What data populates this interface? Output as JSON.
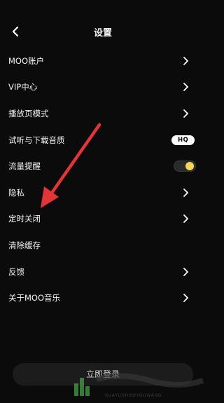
{
  "header": {
    "title": "设置"
  },
  "settings": {
    "items": [
      {
        "label": "MOO账户",
        "control": "chevron"
      },
      {
        "label": "VIP中心",
        "control": "chevron"
      },
      {
        "label": "播放页模式",
        "control": "chevron"
      },
      {
        "label": "试听与下载音质",
        "control": "badge",
        "badge": "HQ"
      },
      {
        "label": "流量提醒",
        "control": "toggle",
        "toggle_on": true
      },
      {
        "label": "隐私",
        "control": "chevron"
      },
      {
        "label": "定时关闭",
        "control": "chevron"
      },
      {
        "label": "清除缓存",
        "control": "none"
      },
      {
        "label": "反馈",
        "control": "chevron"
      },
      {
        "label": "关于MOO音乐",
        "control": "chevron"
      }
    ]
  },
  "footer": {
    "logout_label": "立即登录"
  },
  "watermark": {
    "text": "KUAYUSHOUYOUWANG"
  },
  "colors": {
    "background": "#0b0b0b",
    "annotation_arrow": "#e33535",
    "toggle_knob": "#f6d35a"
  }
}
